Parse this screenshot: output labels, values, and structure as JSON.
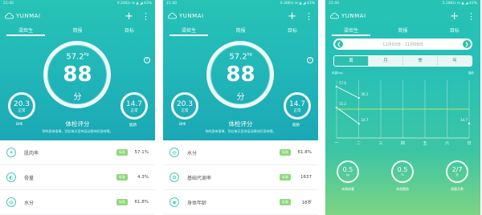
{
  "status": {
    "time": "21:40",
    "right_p1": "0.24K/s  ✉  ▲  ◢  43%",
    "right_p2": "0.36K/s  ✉  ▲  ◢  43%",
    "right_p3": "5.28K/s  ✉  ▲  ◢  43%"
  },
  "brand": "YUNMAI",
  "appbar": {
    "add": "+",
    "more": "⋮"
  },
  "tabs": [
    "梁炬生",
    "简报",
    "目标"
  ],
  "trend_tabs": [
    "梁炬生",
    "简报",
    "目标"
  ],
  "report": {
    "weight": "57.2",
    "weight_unit": "kg",
    "score": "88",
    "score_unit": "分",
    "help": "?",
    "bmi": {
      "value": "20.3",
      "tag": "正常",
      "label": "BMI"
    },
    "fat": {
      "value": "14.7",
      "tag": "正常",
      "label": "脂肪"
    },
    "check_title": "体检评分",
    "check_desc": "你的身体很棒，别忘每天坚持运动保持好身材哦。"
  },
  "list_p1": [
    {
      "icon": "muscle-icon",
      "glyph": "✦",
      "label": "肌肉率",
      "badge": "标准",
      "value": "57.1%"
    },
    {
      "icon": "bone-icon",
      "glyph": "◐",
      "label": "骨量",
      "badge": "标准",
      "value": "4.3%"
    },
    {
      "icon": "water-icon",
      "glyph": "◍",
      "label": "水分",
      "badge": "标准",
      "value": "61.8%"
    }
  ],
  "list_p2": [
    {
      "icon": "water-icon",
      "glyph": "◍",
      "label": "水分",
      "badge": "标准",
      "value": "61.8%"
    },
    {
      "icon": "metabolism-icon",
      "glyph": "✿",
      "label": "基础代谢率",
      "badge": "标准",
      "value": "1637"
    },
    {
      "icon": "body-age-icon",
      "glyph": "◉",
      "label": "身体年龄",
      "badge": "标准",
      "value": "18岁"
    }
  ],
  "trend": {
    "date_range": "11月03日 - 11月09日",
    "prev": "❮",
    "next": "❯",
    "periods": [
      "周",
      "月",
      "季",
      "年"
    ],
    "legend_left": "体重(kg)",
    "legend_right": "脂肪",
    "days": [
      "一",
      "二",
      "三",
      "四",
      "五",
      "六",
      "日"
    ],
    "weight_labels": [
      "57.6",
      "56.2"
    ],
    "fat_labels": [
      "15.2",
      "14.7",
      "14.7"
    ],
    "summary": [
      {
        "value": "0.5",
        "unit": "kg",
        "label": "本周体重"
      },
      {
        "value": "0.5",
        "unit": "%",
        "label": "本周脂肪"
      },
      {
        "value": "2/7",
        "unit": "天",
        "label": "测量天数"
      }
    ]
  },
  "colors": {
    "teal": "#22b8b8",
    "badge_green": "#8fd77b",
    "line_yellow": "#e6f04a"
  },
  "chart_data": {
    "type": "line",
    "categories": [
      "一",
      "二",
      "三",
      "四",
      "五",
      "六",
      "日"
    ],
    "series": [
      {
        "name": "体重(kg)",
        "values": [
          57.6,
          56.2,
          null,
          null,
          null,
          null,
          null
        ]
      },
      {
        "name": "脂肪",
        "values": [
          15.2,
          14.7,
          null,
          null,
          null,
          null,
          14.7
        ]
      }
    ]
  }
}
